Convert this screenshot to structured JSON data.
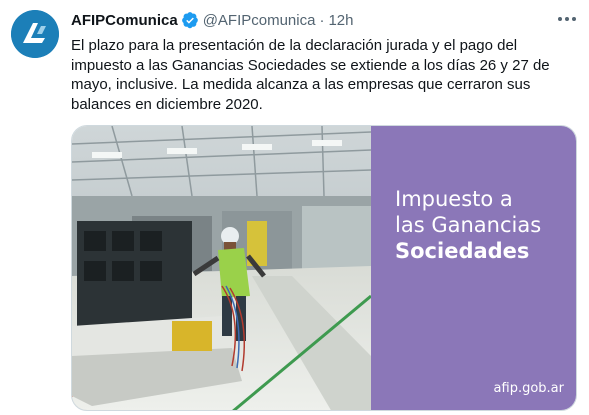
{
  "tweet": {
    "author_name": "AFIPComunica",
    "handle": "@AFIPcomunica",
    "separator": "·",
    "time": "12h",
    "text": "El plazo para la presentación de la declaración jurada y el pago del impuesto a las Ganancias Sociedades se extiende a los días 26 y 27 de mayo, inclusive. La medida alcanza a las empresas que cerraron sus balances en diciembre 2020."
  },
  "media": {
    "title_line1": "Impuesto a",
    "title_line2": "las Ganancias",
    "title_line3": "Sociedades",
    "brand": "afip.gob.ar"
  },
  "colors": {
    "avatar_bg": "#1c7fb8",
    "verified": "#1d9bf0",
    "panel_bg": "#8b77b8",
    "text": "#0f1419",
    "secondary": "#536471"
  },
  "icons": {
    "avatar": "afip-logo-icon",
    "verified": "verified-badge-icon",
    "more": "more-options-icon"
  }
}
